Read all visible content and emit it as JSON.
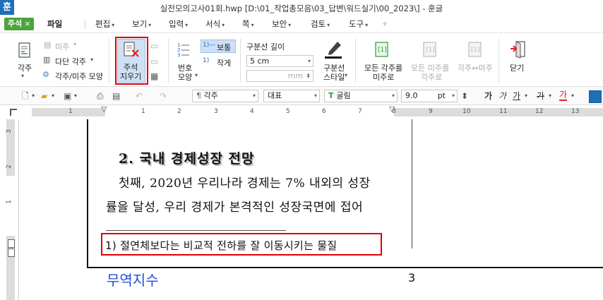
{
  "title": {
    "logo": "훈",
    "text": "실전모의고사01회.hwp [D:\\01_작업총모음\\03_답변\\워드실기\\00_2023\\] - 훈글"
  },
  "menubar": {
    "active_tab": "주석",
    "active_tab_close": "×",
    "items": [
      "파일",
      "편집",
      "보기",
      "입력",
      "서식",
      "쪽",
      "보안",
      "검토",
      "도구"
    ]
  },
  "ribbon": {
    "footnote_btn": "각주",
    "endnote": "미주",
    "multi_footnote": "다단 각주",
    "footnote_endnote_shape": "각주/미주 모양",
    "delete_annotation_line1": "주석",
    "delete_annotation_line2": "지우기",
    "numbering_line1": "번호",
    "numbering_line2": "모양",
    "normal_label": "보통",
    "small_label": "작게",
    "sep_length_label": "구분선 길이",
    "sep_length_value": "5 cm",
    "sep_mm_value": "",
    "sep_mm_unit": "mm",
    "sep_style_line1": "구분선",
    "sep_style_line2": "스타일",
    "all_to_endnote_line1": "모든 각주를",
    "all_to_endnote_line2": "미주로",
    "all_to_footnote_line1": "모든 미주를",
    "all_to_footnote_line2": "각주로",
    "swap_label": "각주↔미주",
    "close_label": "닫기"
  },
  "toolbar2": {
    "style": "각주",
    "lang": "대표",
    "font": "굴림",
    "size": "9.0",
    "unit": "pt"
  },
  "ruler": {
    "numbers": [
      "1",
      "1",
      "2",
      "3",
      "4",
      "5",
      "6",
      "7",
      "8",
      "9",
      "10",
      "11",
      "12",
      "13"
    ],
    "vnumbers": [
      "3",
      "2",
      "1"
    ]
  },
  "document": {
    "heading": "2. 국내 경제성장 전망",
    "line1": "첫째, 2020년 우리나라 경제는 7% 내외의 성장",
    "line2": "률을 달성, 우리 경제가 본격적인 성장국면에 접어",
    "footnote": "1) 절연체보다는 비교적 전하를 잘 이동시키는 물질",
    "page_number": "3",
    "blue_note": "무역지수"
  },
  "colors": {
    "accent_green": "#4aa43b",
    "highlight_red": "#e00000",
    "blue_text": "#1f4fd6"
  }
}
